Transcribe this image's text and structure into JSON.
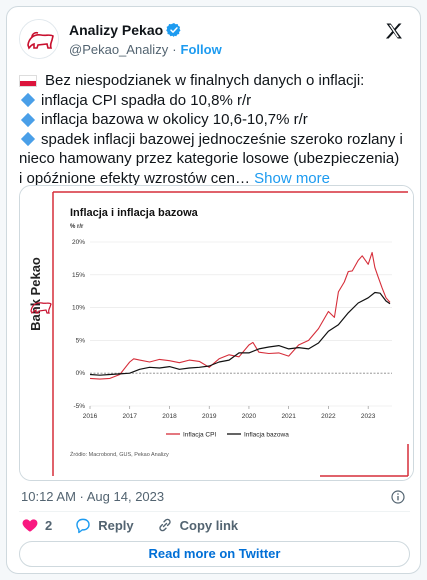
{
  "account": {
    "name": "Analizy Pekao",
    "handle": "@Pekao_Analizy",
    "separator": "·",
    "follow": "Follow"
  },
  "tweet": {
    "lines": [
      "Bez niespodzianek w finalnych danych o inflacji:",
      "inflacja CPI spadła do 10,8% r/r",
      "inflacja bazowa w okolicy 10,6-10,7% r/r",
      "spadek inflacji bazowej jednocześnie szeroko rozlany i",
      "nieco hamowany przez kategorie losowe (ubezpieczenia)",
      "i opóźnione efekty wzrostów cen…"
    ],
    "show_more": "Show more"
  },
  "media": {
    "brand": "Bank Pekao",
    "source": "Źródło: Macrobond, GUS, Pekao Analizy"
  },
  "chart_data": {
    "type": "line",
    "title": "Inflacja i inflacja bazowa",
    "ylabel": "% r/r",
    "ylim": [
      -5,
      20
    ],
    "yticks": [
      "-5%",
      "0%",
      "5%",
      "10%",
      "15%",
      "20%"
    ],
    "xlim": [
      2016,
      2023.6
    ],
    "xticks": [
      "2016",
      "2017",
      "2018",
      "2019",
      "2020",
      "2021",
      "2022",
      "2023"
    ],
    "colors": {
      "cpi": "#d62e3a",
      "core": "#111111"
    },
    "series": [
      {
        "name": "Inflacja CPI",
        "x": [
          2016.0,
          2016.25,
          2016.5,
          2016.75,
          2017.0,
          2017.1,
          2017.25,
          2017.5,
          2017.75,
          2018.0,
          2018.25,
          2018.5,
          2018.75,
          2019.0,
          2019.25,
          2019.5,
          2019.75,
          2020.0,
          2020.1,
          2020.25,
          2020.5,
          2020.75,
          2021.0,
          2021.25,
          2021.5,
          2021.75,
          2022.0,
          2022.15,
          2022.25,
          2022.4,
          2022.5,
          2022.6,
          2022.75,
          2022.85,
          2023.0,
          2023.1,
          2023.17,
          2023.25,
          2023.35,
          2023.45,
          2023.55
        ],
        "values": [
          -0.8,
          -0.9,
          -0.8,
          -0.2,
          1.7,
          2.2,
          2.0,
          1.7,
          2.1,
          1.9,
          1.6,
          2.0,
          1.8,
          0.9,
          2.2,
          2.8,
          2.5,
          4.3,
          4.7,
          3.2,
          3.0,
          3.1,
          2.6,
          4.3,
          5.0,
          6.8,
          9.4,
          8.5,
          12.4,
          13.9,
          15.5,
          15.6,
          17.2,
          17.9,
          16.6,
          18.4,
          16.1,
          14.7,
          13.0,
          11.5,
          10.8
        ]
      },
      {
        "name": "Inflacja bazowa",
        "x": [
          2016.0,
          2016.25,
          2016.5,
          2016.75,
          2017.0,
          2017.25,
          2017.5,
          2017.75,
          2018.0,
          2018.25,
          2018.5,
          2018.75,
          2019.0,
          2019.25,
          2019.5,
          2019.75,
          2020.0,
          2020.25,
          2020.5,
          2020.75,
          2021.0,
          2021.25,
          2021.5,
          2021.75,
          2022.0,
          2022.25,
          2022.5,
          2022.75,
          2023.0,
          2023.17,
          2023.3,
          2023.45,
          2023.55
        ],
        "values": [
          -0.2,
          -0.3,
          -0.2,
          -0.1,
          0.0,
          0.6,
          0.9,
          0.8,
          1.0,
          0.6,
          0.8,
          0.9,
          1.1,
          1.7,
          2.0,
          3.1,
          3.1,
          3.7,
          4.0,
          4.2,
          3.7,
          3.9,
          3.7,
          4.6,
          6.4,
          7.4,
          9.2,
          10.7,
          11.5,
          12.3,
          12.2,
          11.0,
          10.6
        ]
      }
    ],
    "legend": "bottom"
  },
  "meta": {
    "timestamp": "10:12 AM · Aug 14, 2023"
  },
  "actions": {
    "like_count": "2",
    "reply": "Reply",
    "copy": "Copy link"
  },
  "cta": {
    "read_more": "Read more on Twitter"
  }
}
